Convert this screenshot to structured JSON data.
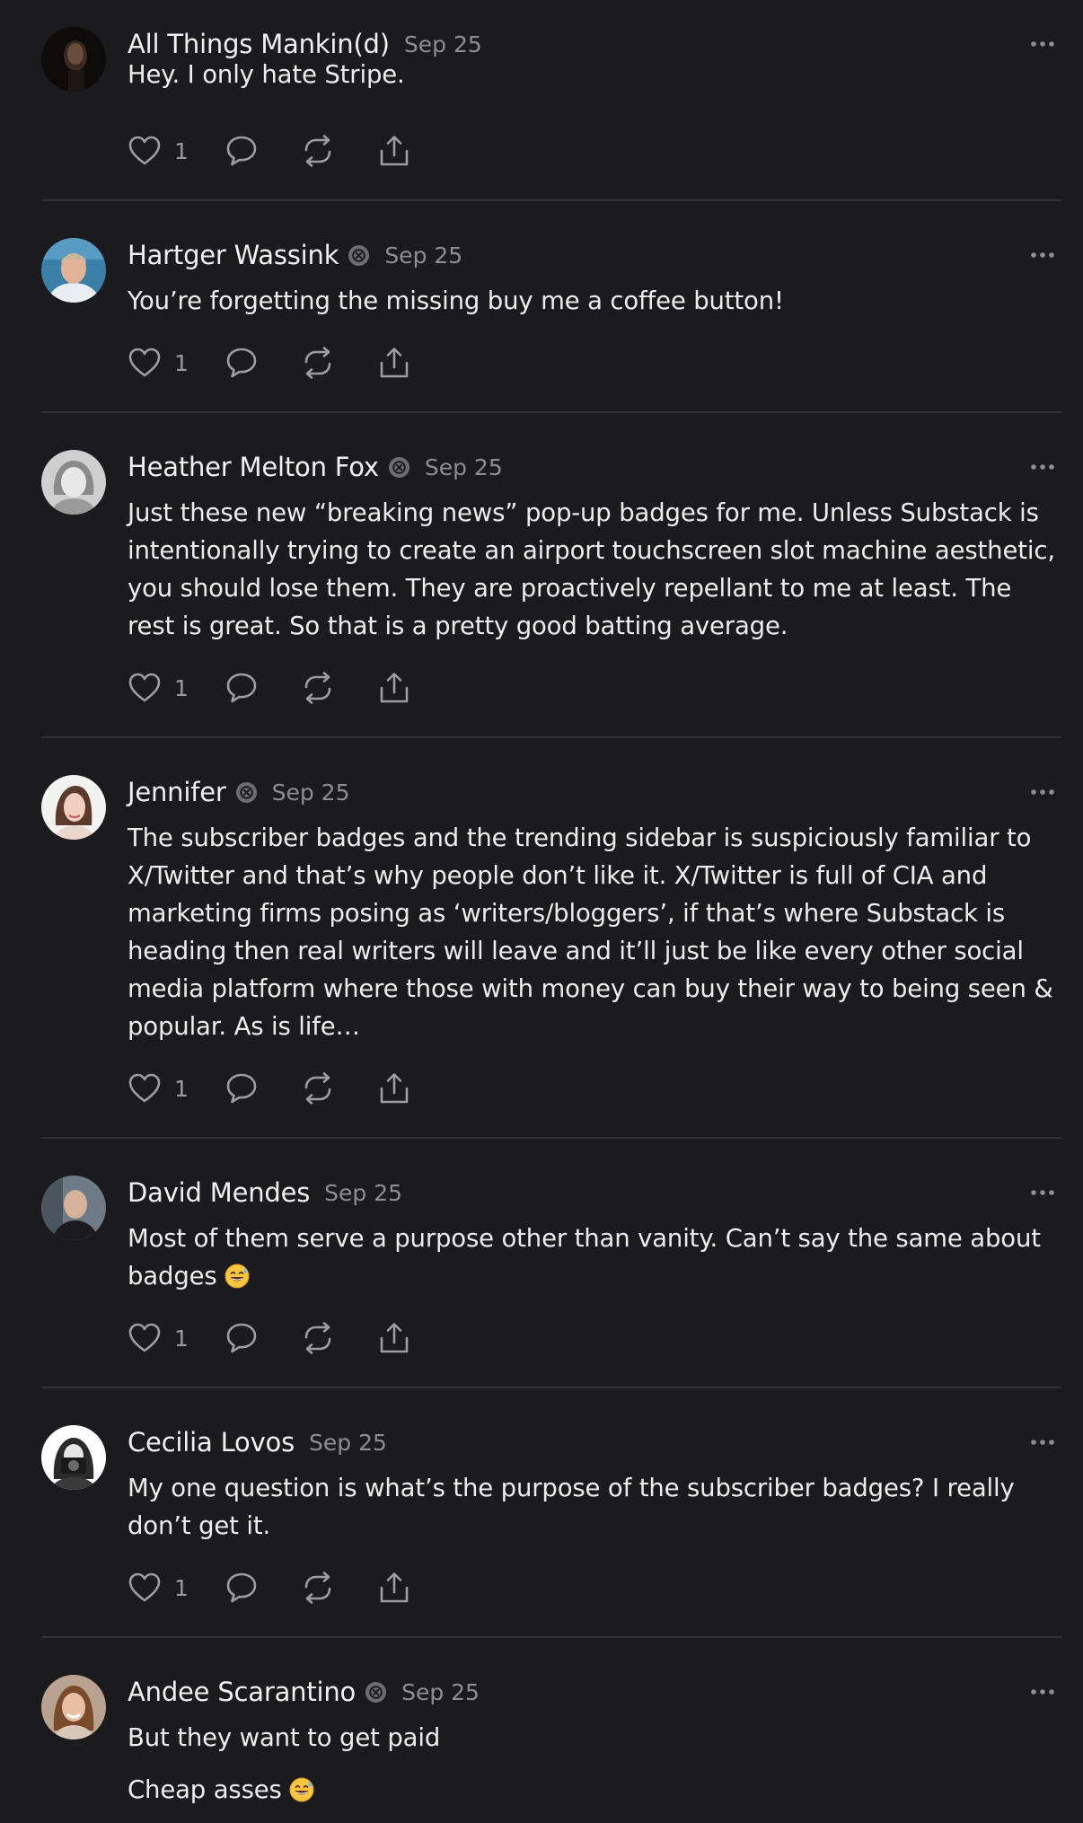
{
  "comments": [
    {
      "author": "All Things Mankin(d)",
      "has_badge": false,
      "date": "Sep 25",
      "paragraphs": [
        "Hey. I only hate Stripe."
      ],
      "likes": "1",
      "avatar": "dark-portrait"
    },
    {
      "author": "Hartger Wassink",
      "has_badge": true,
      "date": "Sep 25",
      "paragraphs": [
        "You’re forgetting the missing buy me a coffee button!"
      ],
      "likes": "1",
      "avatar": "man-portrait"
    },
    {
      "author": "Heather Melton Fox",
      "has_badge": true,
      "date": "Sep 25",
      "paragraphs": [
        "Just these new “breaking news” pop-up badges for me. Unless Substack is intentionally trying to create an airport touchscreen slot machine aesthetic, you should lose them. They are proactively repellant to me at least. The rest is great. So that is a pretty good batting average."
      ],
      "likes": "1",
      "avatar": "woman-bw-portrait"
    },
    {
      "author": "Jennifer",
      "has_badge": true,
      "date": "Sep 25",
      "paragraphs": [
        "The subscriber badges and the trending sidebar is suspiciously familiar to X/Twitter and that’s why people don’t like it. X/Twitter is full of CIA and marketing firms posing as ‘writers/bloggers’, if that’s where Substack is heading then real writers will leave and it’ll just be like every other social media platform where those with money can buy their way to being seen & popular. As is life…"
      ],
      "likes": "1",
      "avatar": "woman-portrait"
    },
    {
      "author": "David Mendes",
      "has_badge": false,
      "date": "Sep 25",
      "paragraphs": [
        "Most of them serve a purpose other than vanity. Can’t say the same about badges"
      ],
      "emoji_after": [
        true
      ],
      "likes": "1",
      "avatar": "man-bald-portrait"
    },
    {
      "author": "Cecilia Lovos",
      "has_badge": false,
      "date": "Sep 25",
      "paragraphs": [
        "My one question is what’s the purpose of the subscriber badges? I really don’t get it."
      ],
      "likes": "1",
      "avatar": "camera-portrait"
    },
    {
      "author": "Andee Scarantino",
      "has_badge": true,
      "date": "Sep 25",
      "paragraphs": [
        "But they want to get paid",
        "Cheap asses"
      ],
      "emoji_after": [
        false,
        true
      ],
      "likes": "",
      "avatar": "woman-smiling-portrait"
    }
  ],
  "icons": {
    "like": "heart-icon",
    "reply": "comment-bubble-icon",
    "restack": "restack-icon",
    "share": "share-icon",
    "more": "more-dots-icon",
    "badge": "subscriber-badge-icon",
    "emoji": "grinning-sweat-emoji"
  },
  "colors": {
    "background": "#1b1b1d",
    "text": "#ececec",
    "muted": "#8d8d92",
    "divider": "#323236"
  }
}
